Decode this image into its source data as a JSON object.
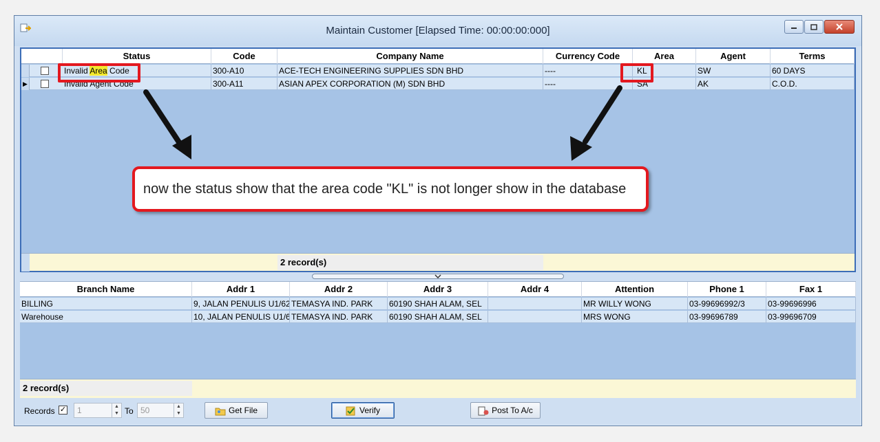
{
  "window": {
    "title": "Maintain Customer [Elapsed Time: 00:00:00:000]"
  },
  "grid1": {
    "columns": [
      "Status",
      "Code",
      "Company Name",
      "Currency Code",
      "Area",
      "Agent",
      "Terms"
    ],
    "rows": [
      {
        "status_pre": "Invalid ",
        "status_hl": "Area",
        "status_post": " Code",
        "code": "300-A10",
        "company": "ACE-TECH ENGINEERING SUPPLIES SDN BHD",
        "currency": "----",
        "area": "KL",
        "agent": "SW",
        "terms": "60 DAYS"
      },
      {
        "status": "Invalid Agent Code",
        "code": "300-A11",
        "company": "ASIAN APEX CORPORATION (M) SDN BHD",
        "currency": "----",
        "area": "SA",
        "agent": "AK",
        "terms": "C.O.D."
      }
    ],
    "record_count": "2 record(s)"
  },
  "grid2": {
    "columns": [
      "Branch Name",
      "Addr 1",
      "Addr 2",
      "Addr 3",
      "Addr 4",
      "Attention",
      "Phone 1",
      "Fax 1"
    ],
    "rows": [
      {
        "branch": "BILLING",
        "addr1": "9, JALAN PENULIS U1/62",
        "addr2": "TEMASYA IND. PARK",
        "addr3": "60190 SHAH ALAM, SEL",
        "addr4": "",
        "attention": "MR WILLY WONG",
        "phone": "03-99696992/3",
        "fax": "03-99696996"
      },
      {
        "branch": "Warehouse",
        "addr1": "10, JALAN PENULIS U1/6",
        "addr2": "TEMASYA IND. PARK",
        "addr3": "60190 SHAH ALAM, SEL",
        "addr4": "",
        "attention": "MRS WONG",
        "phone": "03-99696789",
        "fax": "03-99696709"
      }
    ],
    "record_count": "2 record(s)"
  },
  "toolbar": {
    "records_label": "Records",
    "records_checked": "✓",
    "from_value": "1",
    "to_label": "To",
    "to_value": "50",
    "get_file_label": "Get File",
    "verify_label": "Verify",
    "post_label": "Post To A/c"
  },
  "annotation": {
    "callout_text": "now the status show that the area code \"KL\" is not longer show in the database",
    "color": "#e3181f"
  }
}
